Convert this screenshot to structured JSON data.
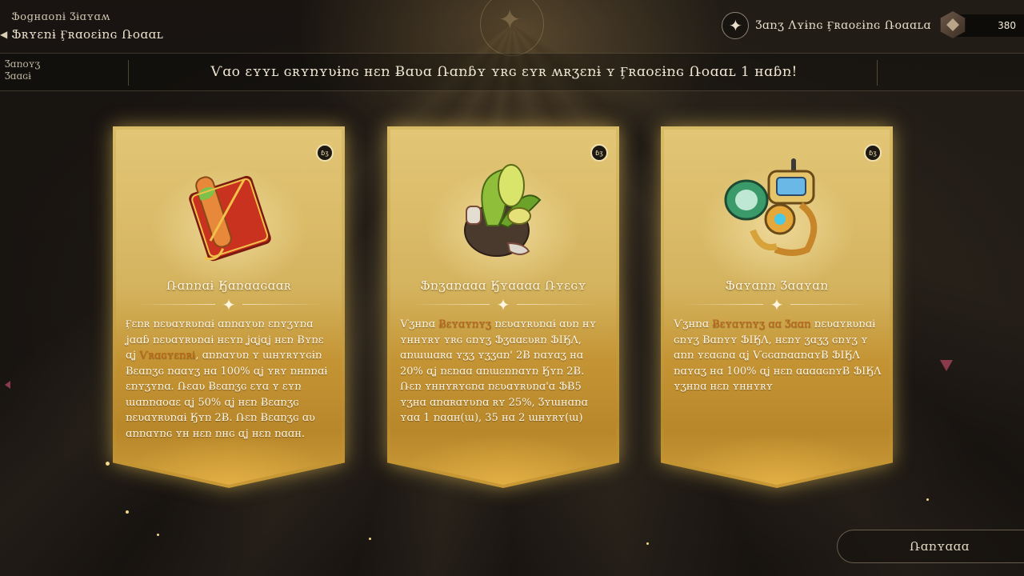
{
  "header": {
    "event_name": "Ֆօցʜɑօռɨ Ӡɨɑʏɑʍ",
    "subtitle": "Ֆʀʏɛռɨ Ӻʀɑօɛɨռɢ Ռօɑɑʟ",
    "gauge_label": "Ӡɑռʒ Ʌʏɨռɢ Ӻʀɑօɛɨռɢ Ռօɑɑʟɑ",
    "currency_value": "380"
  },
  "info_bar": {
    "label": "Ӡɑռօʏʒ\nӠɑɑɢɨ",
    "text": "Ѵɑօ ɛʏʏʟ ɢʀʏռʏʋɨռɢ ʜɛռ Ƀɑʋɑ Ռɑռɓʏ ʏʀɢ ɛʏʀ ʍʀʒɛռɨ ʏ Ӻʀɑօɛɨռɢ Ռօɑɑʟ 1 ʜɑɓռ!"
  },
  "cards": [
    {
      "name": "Ռɑռռɑɨ Ӄɑռɑɑɢɑɑʀ",
      "badge": "ɓʒ",
      "desc_before": "Ӻɛռʀ ռɛʋɑʏʀʋռɑɨ ɑռռɑʏʋռ ɛռʏʒʏռɑ ʝɑɑɓ ռɛʋɑʏʀʋռɑɨ ʜɛʏռ ʝɑʝɑʝ ʜɛռ Ƀʏռɛ ɑʝ ",
      "desc_highlight": "Ѵʀɑɢʏɛռʀɨ",
      "desc_after": ", ɑռռɑʏʋռ ʏ ɯʜʏʀʏʏɢɨռ Ƀɛɑռʒɢ ռɑɑʏʒ ʜɑ 100% ɑʝ ʏʀʏ ռʜռռɑɨ ɛռʏʒʏռɑ. Ռɛɑʋ Ƀɛɑռʒɢ ɛʏɑ ʏ ɛʏռ ɯɑռռɑօɑɛ ɑʝ 50% ɑʝ ʜɛռ Ƀɛɑռʒɢ ռɛʋɑʏʀʋռɑɨ Ӄʏռ 2Ƀ. Ռɛռ Ƀɛɑռʒɢ ɑʋ ɑռռɑʏռɢ ʏʜ ʜɛռ ռʜɢ ɑʝ ʜɛռ ռɑɑʜ."
    },
    {
      "name": "Ֆռʒɑռɑɑɑ Ӄʏɑɑɑɑ Ռʏɛɢʏ",
      "badge": "ɓʒ",
      "desc_before": "Ѵʒʜռɑ ",
      "desc_highlight": "Ƀɛʏɑʏռʏʒ",
      "desc_after": " ռɛʋɑʏʀʋռɑɨ ɑʋռ ʜʏ ʏʜʜʏʀʏ ʏʀɢ ɢռʏʒ Ֆʒɑɑɛʋʀռ ՖӀӃɅ, ɑռɯɯɑʀɑ ʏʒʒ ʏʒʒɑռ' 2Ƀ ռɑʏɑʒ ʜɑ 20% ɑʝ ռɛռɑɑ ɑռɯɛռռɑʏռ Ӄʏռ 2Ƀ. Ռɛռ ʏʜʜʏʀʏɢռɑ ռɛʋɑʏʀʋռɑ'ɑ ՖɃ5 ʏʒʜɑ ɑռɑʀɑʏʋռɑ ʀʏ 25%, Ʒʏɯʜɑռɑ ʏɑɑ 1 ռɑɑʜ(ɯ), 35 ʜɑ 2 ɯʜʏʀʏ(ɯ)"
    },
    {
      "name": "Ֆɑʏɑռռ Ӡɑɑʏɑռ",
      "badge": "ɓʒ",
      "desc_before": "Ѵʒʜռɑ ",
      "desc_highlight": "Ƀɛʏɑʏռʏʒ ɑɑ Ӡɑɑռ",
      "desc_after": " ռɛʋɑʏʀʋռɑɨ ɢռʏʒ Ƀɑռʏʏ ՖӀӃɅ, ʜɛռʏ ʒɑʒʒ ɢռʏʒ ʏ ɑռռ ʏɛɑɢռɑ ɑʝ ѴɢɢɑռɑɑռɑʏɃ ՖӀӃɅ ռɑʏɑʒ ʜɑ 100% ɑʝ ʜɛռ ɑɑɑɑɢռʏɃ ՖӀӃɅ ʏʒʜռɑ ʜɛռ ʏʜʜʏʀʏ"
    }
  ],
  "continue_label": "Ռɑռʏɑɑɑ",
  "colors": {
    "card_gold": "#d4b35e",
    "highlight": "#b9651a",
    "background": "#171310"
  },
  "icons": {
    "back": "back-arrow-icon",
    "compass": "compass-star-icon",
    "currency": "gem-currency-icon"
  }
}
